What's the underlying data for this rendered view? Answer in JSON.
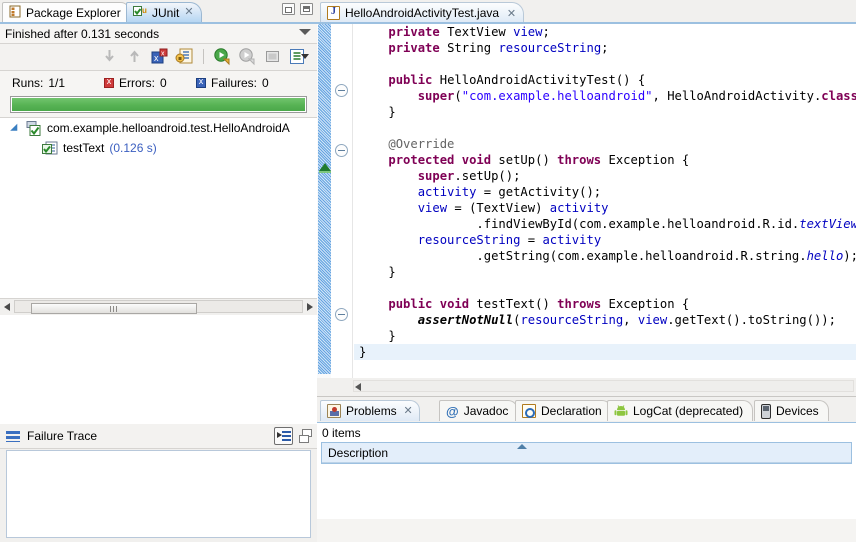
{
  "left_view": {
    "tabs": [
      {
        "label": "Package Explorer",
        "icon": "package-explorer-icon",
        "active": false
      },
      {
        "label": "JUnit",
        "icon": "junit-icon",
        "active": true
      }
    ],
    "window_buttons": [
      {
        "name": "minimize-button",
        "label": "Minimize"
      },
      {
        "name": "maximize-button",
        "label": "Maximize"
      }
    ],
    "status": "Finished after 0.131 seconds",
    "toolbar_icons": [
      "next-failed-test-icon",
      "previous-failed-test-icon",
      "show-failures-only-icon",
      "show-tests-in-hierarchy-icon",
      "rerun-test-icon",
      "rerun-test-failures-icon",
      "stop-test-run-icon",
      "test-run-history-icon",
      "view-menu-icon"
    ],
    "counters": {
      "runs_label": "Runs:",
      "runs_value": "1/1",
      "errors_label": "Errors:",
      "errors_value": "0",
      "failures_label": "Failures:",
      "failures_value": "0"
    },
    "progress": {
      "percent": 100,
      "color": "#57b354"
    },
    "tree": [
      {
        "label": "com.example.helloandroid.test.HelloAndroidA",
        "icon": "test-class-icon",
        "time": "",
        "level": 1
      },
      {
        "label": "testText",
        "icon": "test-method-icon",
        "time": "(0.126 s)",
        "level": 2
      }
    ],
    "failure_trace": {
      "title": "Failure Trace",
      "buttons": [
        "compare-result-button",
        "restore-button",
        "minimize-button"
      ]
    }
  },
  "editor": {
    "tab": {
      "label": "HelloAndroidActivityTest.java",
      "icon": "java-file-icon",
      "close": "╳"
    },
    "fold_markers": [
      88,
      148,
      312
    ],
    "overview_marker": "task-marker-green",
    "lines": [
      {
        "indent": 1,
        "cur": false,
        "tokens": [
          {
            "t": "private ",
            "c": "kw"
          },
          {
            "t": "TextView ",
            "c": ""
          },
          {
            "t": "view",
            "c": "fld"
          },
          {
            "t": ";",
            "c": ""
          }
        ]
      },
      {
        "indent": 1,
        "cur": false,
        "tokens": [
          {
            "t": "private ",
            "c": "kw"
          },
          {
            "t": "String ",
            "c": ""
          },
          {
            "t": "resourceString",
            "c": "fld"
          },
          {
            "t": ";",
            "c": ""
          }
        ]
      },
      {
        "indent": 0,
        "cur": false,
        "tokens": []
      },
      {
        "indent": 1,
        "cur": false,
        "tokens": [
          {
            "t": "public ",
            "c": "kw"
          },
          {
            "t": "HelloAndroidActivityTest() {",
            "c": ""
          }
        ]
      },
      {
        "indent": 2,
        "cur": false,
        "tokens": [
          {
            "t": "super",
            "c": "kw"
          },
          {
            "t": "(",
            "c": ""
          },
          {
            "t": "\"com.example.helloandroid\"",
            "c": "str"
          },
          {
            "t": ", HelloAndroidActivity.",
            "c": ""
          },
          {
            "t": "class",
            "c": "kw"
          },
          {
            "t": ");",
            "c": ""
          }
        ]
      },
      {
        "indent": 1,
        "cur": false,
        "tokens": [
          {
            "t": "}",
            "c": ""
          }
        ]
      },
      {
        "indent": 0,
        "cur": false,
        "tokens": []
      },
      {
        "indent": 1,
        "cur": false,
        "tokens": [
          {
            "t": "@Override",
            "c": "ann"
          }
        ]
      },
      {
        "indent": 1,
        "cur": false,
        "tokens": [
          {
            "t": "protected ",
            "c": "kw"
          },
          {
            "t": "void ",
            "c": "kw"
          },
          {
            "t": "setUp() ",
            "c": ""
          },
          {
            "t": "throws ",
            "c": "kw"
          },
          {
            "t": "Exception {",
            "c": ""
          }
        ]
      },
      {
        "indent": 2,
        "cur": false,
        "tokens": [
          {
            "t": "super",
            "c": "kw"
          },
          {
            "t": ".setUp();",
            "c": ""
          }
        ]
      },
      {
        "indent": 2,
        "cur": false,
        "tokens": [
          {
            "t": "activity",
            "c": "fld"
          },
          {
            "t": " = getActivity();",
            "c": ""
          }
        ]
      },
      {
        "indent": 2,
        "cur": false,
        "tokens": [
          {
            "t": "view",
            "c": "fld"
          },
          {
            "t": " = (TextView) ",
            "c": ""
          },
          {
            "t": "activity",
            "c": "fld"
          }
        ]
      },
      {
        "indent": 4,
        "cur": false,
        "tokens": [
          {
            "t": ".findViewById(com.example.helloandroid.R.id.",
            "c": ""
          },
          {
            "t": "textView",
            "c": "sfld"
          },
          {
            "t": ");",
            "c": ""
          }
        ]
      },
      {
        "indent": 2,
        "cur": false,
        "tokens": [
          {
            "t": "resourceString",
            "c": "fld"
          },
          {
            "t": " = ",
            "c": ""
          },
          {
            "t": "activity",
            "c": "fld"
          }
        ]
      },
      {
        "indent": 4,
        "cur": false,
        "tokens": [
          {
            "t": ".getString(com.example.helloandroid.R.string.",
            "c": ""
          },
          {
            "t": "hello",
            "c": "sfld"
          },
          {
            "t": ");",
            "c": ""
          }
        ]
      },
      {
        "indent": 1,
        "cur": false,
        "tokens": [
          {
            "t": "}",
            "c": ""
          }
        ]
      },
      {
        "indent": 0,
        "cur": false,
        "tokens": []
      },
      {
        "indent": 1,
        "cur": false,
        "tokens": [
          {
            "t": "public ",
            "c": "kw"
          },
          {
            "t": "void ",
            "c": "kw"
          },
          {
            "t": "testText() ",
            "c": ""
          },
          {
            "t": "throws ",
            "c": "kw"
          },
          {
            "t": "Exception {",
            "c": ""
          }
        ]
      },
      {
        "indent": 2,
        "cur": false,
        "tokens": [
          {
            "t": "assertNotNull",
            "c": "sm"
          },
          {
            "t": "(",
            "c": ""
          },
          {
            "t": "resourceString",
            "c": "fld"
          },
          {
            "t": ", ",
            "c": ""
          },
          {
            "t": "view",
            "c": "fld"
          },
          {
            "t": ".getText().toString());",
            "c": ""
          }
        ]
      },
      {
        "indent": 1,
        "cur": false,
        "tokens": [
          {
            "t": "}",
            "c": ""
          }
        ]
      },
      {
        "indent": 0,
        "cur": true,
        "tokens": [
          {
            "t": "}",
            "c": ""
          }
        ]
      }
    ]
  },
  "bottom_panel": {
    "tabs": [
      {
        "label": "Problems",
        "icon": "problems-icon",
        "active": true,
        "close": "╳"
      },
      {
        "label": "Javadoc",
        "icon": "javadoc-icon",
        "active": false
      },
      {
        "label": "Declaration",
        "icon": "declaration-icon",
        "active": false
      },
      {
        "label": "LogCat (deprecated)",
        "icon": "logcat-android-icon",
        "active": false
      },
      {
        "label": "Devices",
        "icon": "devices-icon",
        "active": false
      }
    ],
    "item_count": "0 items",
    "columns": [
      "Description"
    ],
    "sort": "ascending"
  }
}
